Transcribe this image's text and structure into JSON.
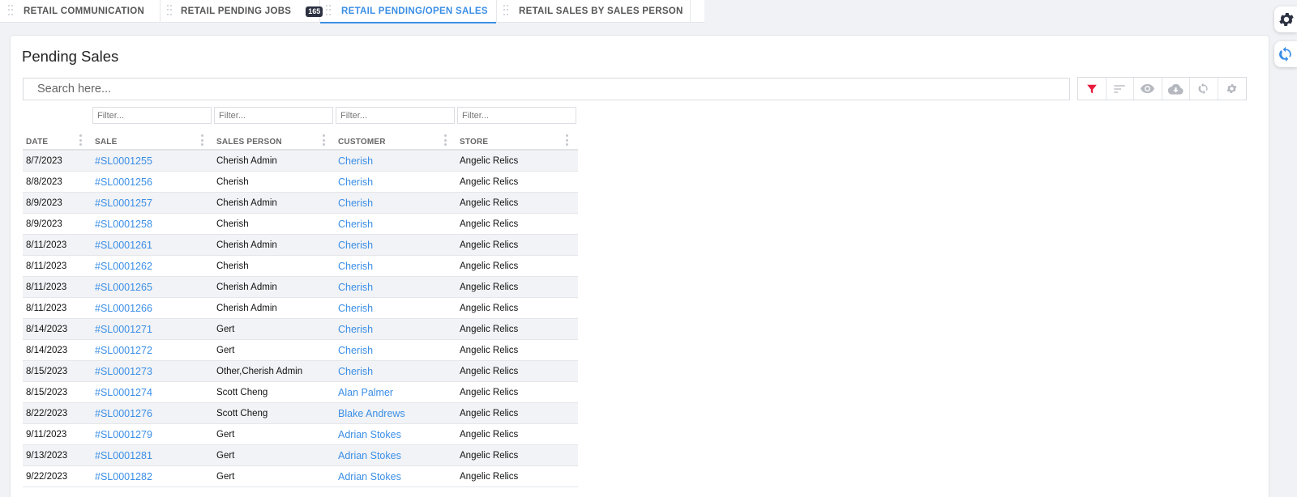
{
  "tabs": [
    {
      "label": "RETAIL COMMUNICATION",
      "active": false
    },
    {
      "label": "RETAIL PENDING JOBS",
      "active": false,
      "badge": "165"
    },
    {
      "label": "RETAIL PENDING/OPEN SALES",
      "active": true
    },
    {
      "label": "RETAIL SALES BY SALES PERSON",
      "active": false
    }
  ],
  "side_buttons": {
    "settings_icon": "gear-icon",
    "refresh_icon": "sync-icon"
  },
  "page": {
    "title": "Pending Sales"
  },
  "search": {
    "placeholder": "Search here..."
  },
  "toolbar": {
    "icons": [
      "filter-icon",
      "sort-icon",
      "eye-icon",
      "cloud-download-icon",
      "refresh-icon",
      "settings-icon"
    ]
  },
  "grid": {
    "filter_placeholder": "Filter...",
    "columns": [
      "DATE",
      "SALE",
      "SALES PERSON",
      "CUSTOMER",
      "STORE"
    ],
    "rows": [
      {
        "date": "8/7/2023",
        "sale": "#SL0001255",
        "sales_person": "Cherish Admin",
        "customer": "Cherish",
        "store": "Angelic Relics"
      },
      {
        "date": "8/8/2023",
        "sale": "#SL0001256",
        "sales_person": "Cherish",
        "customer": "Cherish",
        "store": "Angelic Relics"
      },
      {
        "date": "8/9/2023",
        "sale": "#SL0001257",
        "sales_person": "Cherish Admin",
        "customer": "Cherish",
        "store": "Angelic Relics"
      },
      {
        "date": "8/9/2023",
        "sale": "#SL0001258",
        "sales_person": "Cherish",
        "customer": "Cherish",
        "store": "Angelic Relics"
      },
      {
        "date": "8/11/2023",
        "sale": "#SL0001261",
        "sales_person": "Cherish Admin",
        "customer": "Cherish",
        "store": "Angelic Relics"
      },
      {
        "date": "8/11/2023",
        "sale": "#SL0001262",
        "sales_person": "Cherish",
        "customer": "Cherish",
        "store": "Angelic Relics"
      },
      {
        "date": "8/11/2023",
        "sale": "#SL0001265",
        "sales_person": "Cherish Admin",
        "customer": "Cherish",
        "store": "Angelic Relics"
      },
      {
        "date": "8/11/2023",
        "sale": "#SL0001266",
        "sales_person": "Cherish Admin",
        "customer": "Cherish",
        "store": "Angelic Relics"
      },
      {
        "date": "8/14/2023",
        "sale": "#SL0001271",
        "sales_person": "Gert",
        "customer": "Cherish",
        "store": "Angelic Relics"
      },
      {
        "date": "8/14/2023",
        "sale": "#SL0001272",
        "sales_person": "Gert",
        "customer": "Cherish",
        "store": "Angelic Relics"
      },
      {
        "date": "8/15/2023",
        "sale": "#SL0001273",
        "sales_person": "Other,Cherish Admin",
        "customer": "Cherish",
        "store": "Angelic Relics"
      },
      {
        "date": "8/15/2023",
        "sale": "#SL0001274",
        "sales_person": "Scott Cheng",
        "customer": "Alan Palmer",
        "store": "Angelic Relics"
      },
      {
        "date": "8/22/2023",
        "sale": "#SL0001276",
        "sales_person": "Scott Cheng",
        "customer": "Blake Andrews",
        "store": "Angelic Relics"
      },
      {
        "date": "9/11/2023",
        "sale": "#SL0001279",
        "sales_person": "Gert",
        "customer": "Adrian Stokes",
        "store": "Angelic Relics"
      },
      {
        "date": "9/13/2023",
        "sale": "#SL0001281",
        "sales_person": "Gert",
        "customer": "Adrian Stokes",
        "store": "Angelic Relics"
      },
      {
        "date": "9/22/2023",
        "sale": "#SL0001282",
        "sales_person": "Gert",
        "customer": "Adrian Stokes",
        "store": "Angelic Relics"
      }
    ]
  },
  "colors": {
    "accent": "#3a8ee6",
    "filter_active": "#e8193c",
    "badge": "#2b3140"
  }
}
